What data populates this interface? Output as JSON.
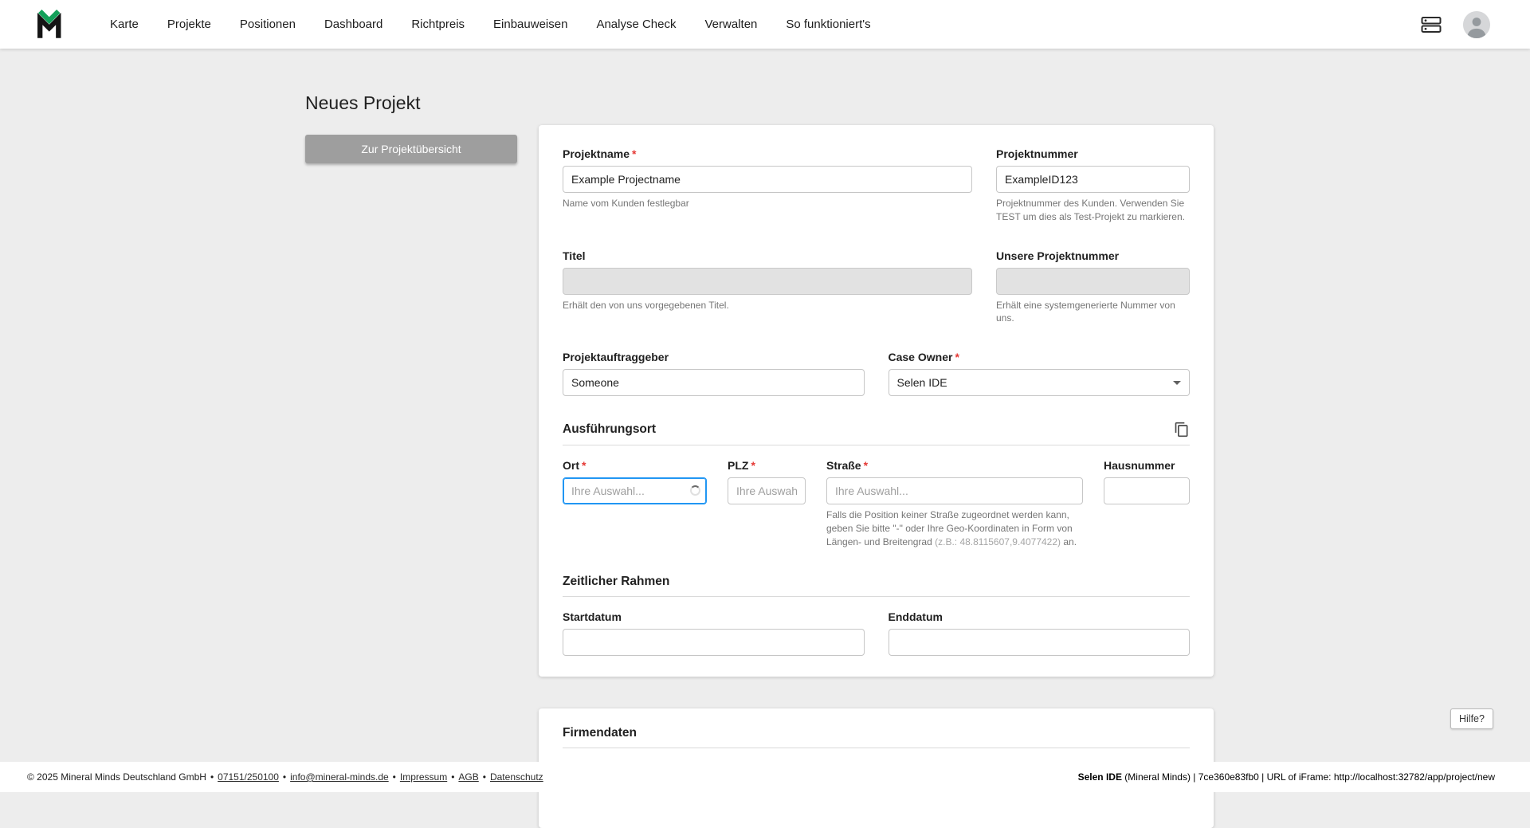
{
  "colors": {
    "brand_green": "#14a05a",
    "required_red": "#e53935",
    "focus_blue": "#2196f3",
    "button_gray": "#9e9e9e",
    "background": "#ededed"
  },
  "ui": {
    "required_marker": "*"
  },
  "navbar": {
    "items": [
      "Karte",
      "Projekte",
      "Positionen",
      "Dashboard",
      "Richtpreis",
      "Einbauweisen",
      "Analyse Check",
      "Verwalten",
      "So funktioniert's"
    ],
    "icons": [
      "mineral-minds-logo",
      "server-icon",
      "avatar"
    ]
  },
  "page": {
    "title": "Neues Projekt",
    "overview_button": "Zur Projektübersicht",
    "help_button": "Hilfe?"
  },
  "form": {
    "projektname": {
      "label": "Projektname",
      "value": "Example Projectname",
      "helper": "Name vom Kunden festlegbar"
    },
    "projektnummer": {
      "label": "Projektnummer",
      "value": "ExampleID123",
      "helper": "Projektnummer des Kunden. Verwenden Sie TEST um dies als Test-Projekt zu markieren."
    },
    "titel": {
      "label": "Titel",
      "value": "",
      "helper": "Erhält den von uns vorgegebenen Titel."
    },
    "unsere_projektnummer": {
      "label": "Unsere Projektnummer",
      "value": "",
      "helper": "Erhält eine systemgenerierte Nummer von uns."
    },
    "projektauftraggeber": {
      "label": "Projektauftraggeber",
      "value": "Someone"
    },
    "case_owner": {
      "label": "Case Owner",
      "value": "Selen IDE"
    },
    "ausfuehrungsort": {
      "heading": "Ausführungsort"
    },
    "ort": {
      "label": "Ort",
      "placeholder": "Ihre Auswahl..."
    },
    "plz": {
      "label": "PLZ",
      "placeholder": "Ihre Auswahl."
    },
    "strasse": {
      "label": "Straße",
      "placeholder": "Ihre Auswahl...",
      "helper_1": "Falls die Position keiner Straße zugeordnet werden kann, geben Sie bitte \"-\" oder Ihre Geo-Koordinaten in Form von Längen- und Breitengrad ",
      "helper_coords": "(z.B.: 48.8115607,9.4077422)",
      "helper_2": " an."
    },
    "hausnummer": {
      "label": "Hausnummer"
    },
    "zeitlicher_rahmen": {
      "heading": "Zeitlicher Rahmen"
    },
    "startdatum": {
      "label": "Startdatum"
    },
    "enddatum": {
      "label": "Enddatum"
    },
    "firmendaten": {
      "heading": "Firmendaten"
    }
  },
  "footer": {
    "copyright": "© 2025 Mineral Minds Deutschland GmbH",
    "separator": "•",
    "links": [
      "07151/250100",
      "info@mineral-minds.de",
      "Impressum",
      "AGB",
      "Datenschutz"
    ],
    "session_bold": "Selen IDE",
    "session_rest": " (Mineral Minds) | 7ce360e83fb0 | URL of iFrame: http://localhost:32782/app/project/new"
  }
}
